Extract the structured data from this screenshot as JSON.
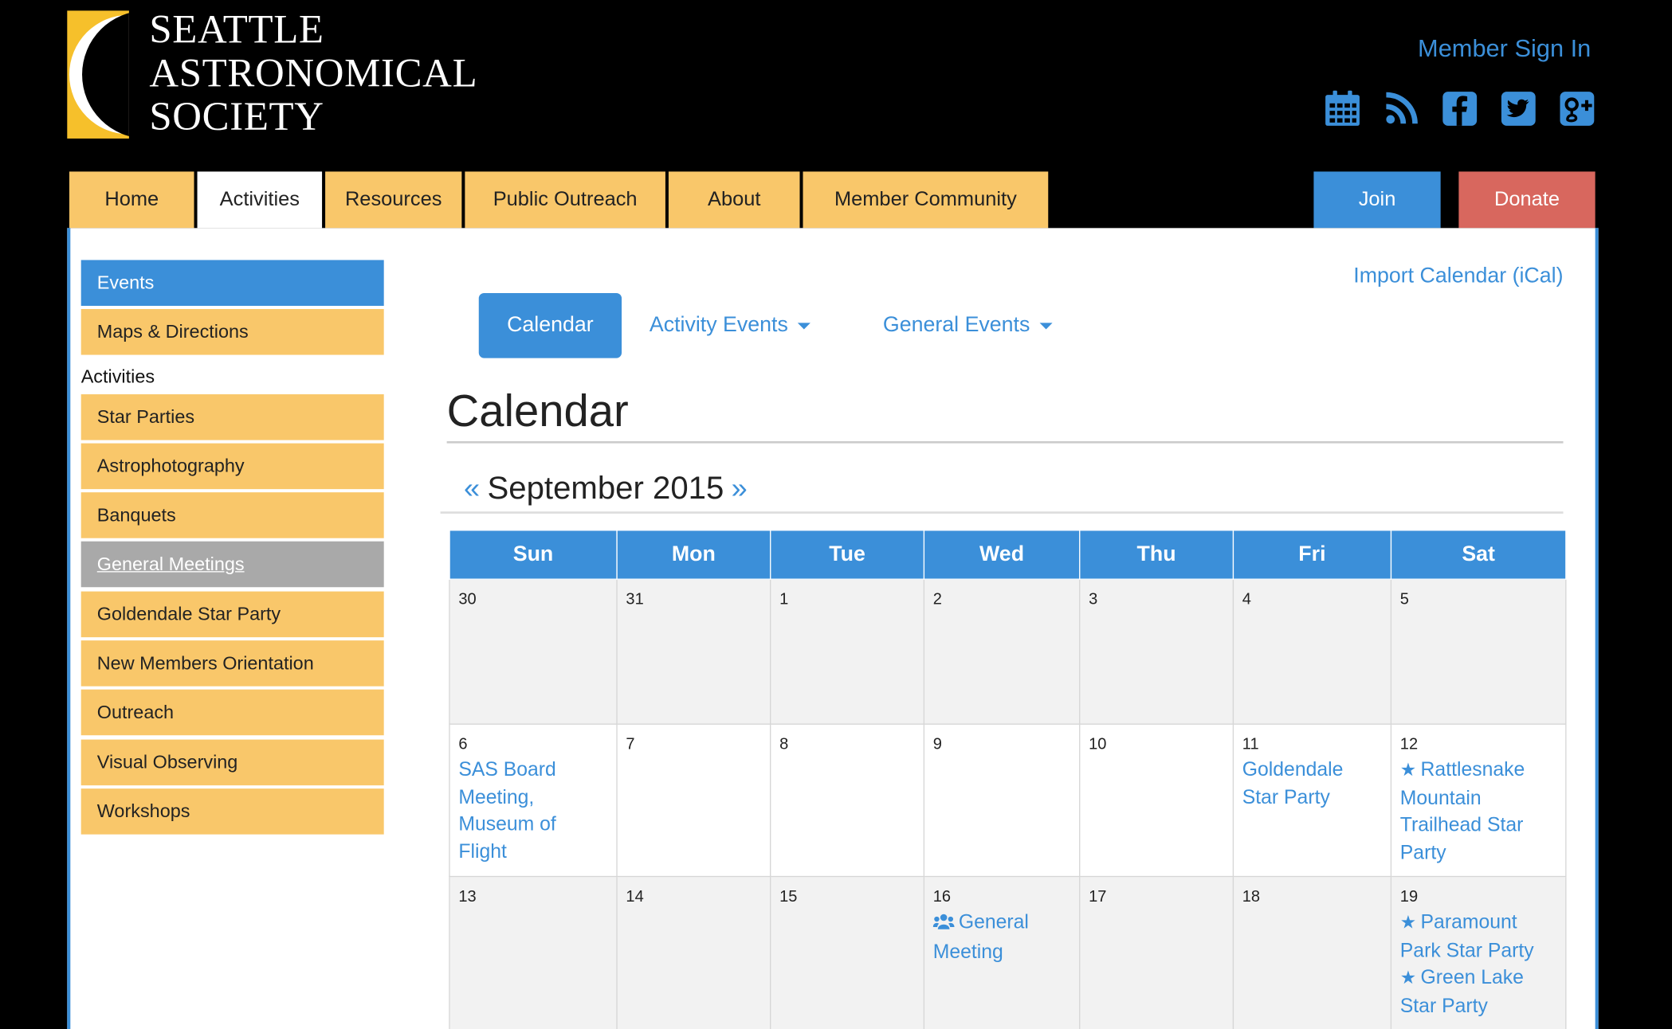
{
  "site": {
    "logo_lines": [
      "SEATTLE",
      "ASTRONOMICAL",
      "SOCIETY"
    ],
    "member_sign_in": "Member Sign In",
    "social_icons": [
      "calendar-icon",
      "rss-icon",
      "facebook-icon",
      "twitter-icon",
      "google-plus-icon"
    ],
    "brand_blue": "#3b8fd9",
    "tab_yellow": "#f9c76a",
    "donate_red": "#d8675e"
  },
  "mainnav": {
    "tabs": [
      "Home",
      "Activities",
      "Resources",
      "Public Outreach",
      "About",
      "Member Community"
    ],
    "active": "Activities",
    "join": "Join",
    "donate": "Donate"
  },
  "sidebar": {
    "top_items": [
      "Events",
      "Maps & Directions"
    ],
    "heading": "Activities",
    "items": [
      "Star Parties",
      "Astrophotography",
      "Banquets",
      "General Meetings",
      "Goldendale Star Party",
      "New Members Orientation",
      "Outreach",
      "Visual Observing",
      "Workshops"
    ]
  },
  "content": {
    "import_ical": "Import Calendar (iCal)",
    "subnav": {
      "calendar": "Calendar",
      "activity_events": "Activity Events",
      "general_events": "General Events"
    },
    "page_title": "Calendar",
    "prev_arrow": "«",
    "month_title": "September 2015",
    "next_arrow": "»"
  },
  "calendar": {
    "weekdays": [
      "Sun",
      "Mon",
      "Tue",
      "Wed",
      "Thu",
      "Fri",
      "Sat"
    ],
    "weeks": [
      [
        {
          "day": "30",
          "events": []
        },
        {
          "day": "31",
          "events": []
        },
        {
          "day": "1",
          "events": []
        },
        {
          "day": "2",
          "events": []
        },
        {
          "day": "3",
          "events": []
        },
        {
          "day": "4",
          "events": []
        },
        {
          "day": "5",
          "events": []
        }
      ],
      [
        {
          "day": "6",
          "events": [
            {
              "label": "SAS Board Meeting, Museum of Flight",
              "icon": ""
            }
          ]
        },
        {
          "day": "7",
          "events": []
        },
        {
          "day": "8",
          "events": []
        },
        {
          "day": "9",
          "events": []
        },
        {
          "day": "10",
          "events": []
        },
        {
          "day": "11",
          "events": [
            {
              "label": "Goldendale Star Party",
              "icon": ""
            }
          ]
        },
        {
          "day": "12",
          "events": [
            {
              "label": "Rattlesnake Mountain Trailhead Star Party",
              "icon": "star-icon"
            }
          ]
        }
      ],
      [
        {
          "day": "13",
          "events": []
        },
        {
          "day": "14",
          "events": []
        },
        {
          "day": "15",
          "events": []
        },
        {
          "day": "16",
          "events": [
            {
              "label": "General Meeting",
              "icon": "users-icon"
            }
          ]
        },
        {
          "day": "17",
          "events": []
        },
        {
          "day": "18",
          "events": []
        },
        {
          "day": "19",
          "events": [
            {
              "label": "Paramount Park Star Party",
              "icon": "star-icon"
            },
            {
              "label": "Green Lake Star Party",
              "icon": "star-icon"
            }
          ]
        }
      ]
    ]
  }
}
